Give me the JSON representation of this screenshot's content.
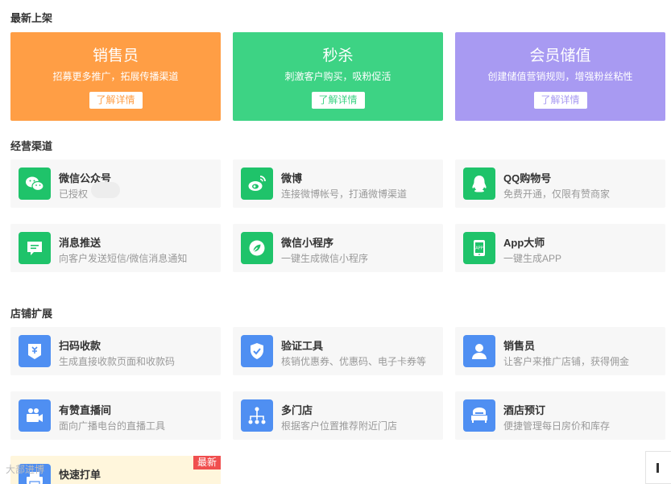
{
  "sections": {
    "newest": "最新上架",
    "channels": "经营渠道",
    "extensions": "店铺扩展"
  },
  "colors": {
    "promo_orange": "#ff9e45",
    "promo_green": "#3dd384",
    "promo_purple": "#a89af2",
    "icon_green": "#1fc36a",
    "icon_blue": "#4f8ff2",
    "badge_red": "#f04f4f"
  },
  "promos": [
    {
      "title": "销售员",
      "desc": "招募更多推广，拓展传播渠道",
      "btn": "了解详情"
    },
    {
      "title": "秒杀",
      "desc": "刺激客户购买，吸粉促活",
      "btn": "了解详情"
    },
    {
      "title": "会员储值",
      "desc": "创建储值营销规则，增强粉丝粘性",
      "btn": "了解详情"
    }
  ],
  "channels": [
    {
      "title": "微信公众号",
      "desc": "已授权",
      "icon": "wechat-icon"
    },
    {
      "title": "微博",
      "desc": "连接微博帐号，打通微博渠道",
      "icon": "weibo-icon"
    },
    {
      "title": "QQ购物号",
      "desc": "免费开通，仅限有赞商家",
      "icon": "qq-icon"
    },
    {
      "title": "消息推送",
      "desc": "向客户发送短信/微信消息通知",
      "icon": "message-icon"
    },
    {
      "title": "微信小程序",
      "desc": "一键生成微信小程序",
      "icon": "mini-program-icon"
    },
    {
      "title": "App大师",
      "desc": "一键生成APP",
      "icon": "app-icon"
    }
  ],
  "extensions": [
    {
      "title": "扫码收款",
      "desc": "生成直接收款页面和收款码",
      "icon": "payment-download-icon"
    },
    {
      "title": "验证工具",
      "desc": "核销优惠券、优惠码、电子卡券等",
      "icon": "shield-check-icon"
    },
    {
      "title": "销售员",
      "desc": "让客户来推广店铺，获得佣金",
      "icon": "person-icon"
    },
    {
      "title": "有赞直播间",
      "desc": "面向广播电台的直播工具",
      "icon": "camera-icon"
    },
    {
      "title": "多门店",
      "desc": "根据客户位置推荐附近门店",
      "icon": "branch-icon"
    },
    {
      "title": "酒店预订",
      "desc": "便捷管理每日房价和库存",
      "icon": "bed-icon"
    },
    {
      "title": "快速打单",
      "desc": "",
      "icon": "printer-icon",
      "badge": "最新"
    }
  ],
  "watermark": "大部进博"
}
